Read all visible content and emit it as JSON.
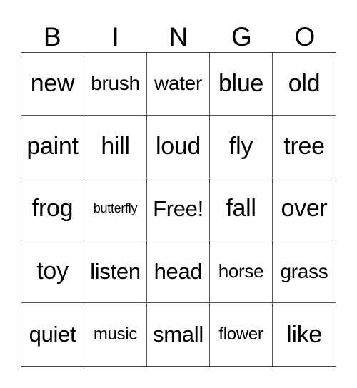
{
  "header": [
    "B",
    "I",
    "N",
    "G",
    "O"
  ],
  "rows": [
    [
      "new",
      "brush",
      "water",
      "blue",
      "old"
    ],
    [
      "paint",
      "hill",
      "loud",
      "fly",
      "tree"
    ],
    [
      "frog",
      "butterfly",
      "Free!",
      "fall",
      "over"
    ],
    [
      "toy",
      "listen",
      "head",
      "horse",
      "grass"
    ],
    [
      "quiet",
      "music",
      "small",
      "flower",
      "like"
    ]
  ]
}
